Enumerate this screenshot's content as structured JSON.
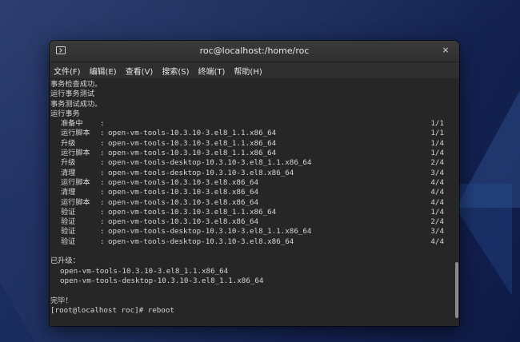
{
  "window": {
    "title": "roc@localhost:/home/roc",
    "close_glyph": "×"
  },
  "menu": [
    "文件(F)",
    "编辑(E)",
    "查看(V)",
    "搜索(S)",
    "终端(T)",
    "帮助(H)"
  ],
  "terminal": {
    "pre_lines": [
      "事务检查成功。",
      "运行事务测试",
      "事务测试成功。",
      "运行事务"
    ],
    "transaction": [
      {
        "action": "准备中",
        "sep": ":",
        "package": "",
        "count": "1/1"
      },
      {
        "action": "运行脚本",
        "sep": ":",
        "package": "open-vm-tools-10.3.10-3.el8_1.1.x86_64",
        "count": "1/1"
      },
      {
        "action": "升级",
        "sep": ":",
        "package": "open-vm-tools-10.3.10-3.el8_1.1.x86_64",
        "count": "1/4"
      },
      {
        "action": "运行脚本",
        "sep": ":",
        "package": "open-vm-tools-10.3.10-3.el8_1.1.x86_64",
        "count": "1/4"
      },
      {
        "action": "升级",
        "sep": ":",
        "package": "open-vm-tools-desktop-10.3.10-3.el8_1.1.x86_64",
        "count": "2/4"
      },
      {
        "action": "清理",
        "sep": ":",
        "package": "open-vm-tools-desktop-10.3.10-3.el8.x86_64",
        "count": "3/4"
      },
      {
        "action": "运行脚本",
        "sep": ":",
        "package": "open-vm-tools-10.3.10-3.el8.x86_64",
        "count": "4/4"
      },
      {
        "action": "清理",
        "sep": ":",
        "package": "open-vm-tools-10.3.10-3.el8.x86_64",
        "count": "4/4"
      },
      {
        "action": "运行脚本",
        "sep": ":",
        "package": "open-vm-tools-10.3.10-3.el8.x86_64",
        "count": "4/4"
      },
      {
        "action": "验证",
        "sep": ":",
        "package": "open-vm-tools-10.3.10-3.el8_1.1.x86_64",
        "count": "1/4"
      },
      {
        "action": "验证",
        "sep": ":",
        "package": "open-vm-tools-10.3.10-3.el8.x86_64",
        "count": "2/4"
      },
      {
        "action": "验证",
        "sep": ":",
        "package": "open-vm-tools-desktop-10.3.10-3.el8_1.1.x86_64",
        "count": "3/4"
      },
      {
        "action": "验证",
        "sep": ":",
        "package": "open-vm-tools-desktop-10.3.10-3.el8.x86_64",
        "count": "4/4"
      }
    ],
    "upgraded_header": "已升级：",
    "upgraded": [
      "open-vm-tools-10.3.10-3.el8_1.1.x86_64",
      "open-vm-tools-desktop-10.3.10-3.el8_1.1.x86_64"
    ],
    "done": "完毕！",
    "prompt": "[root@localhost roc]# reboot"
  }
}
